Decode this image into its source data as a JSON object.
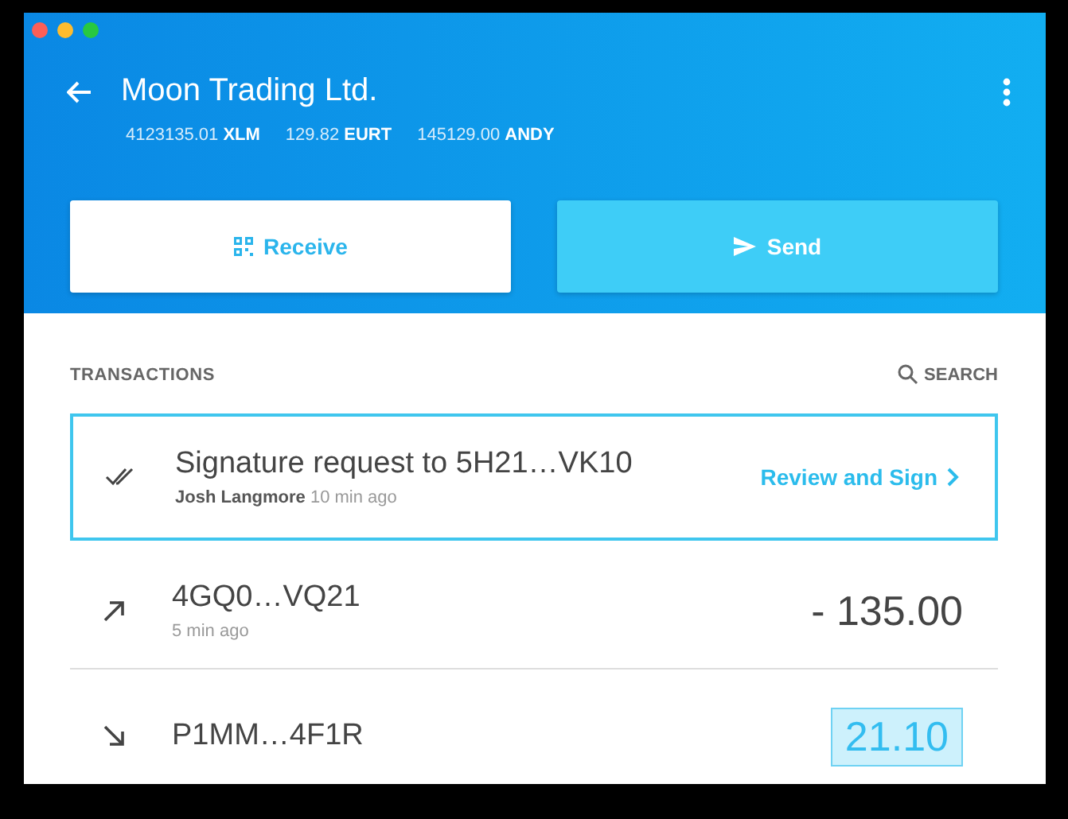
{
  "account": {
    "title": "Moon Trading Ltd.",
    "balances": [
      {
        "amount": "4123135.01",
        "code": "XLM"
      },
      {
        "amount": "129.82",
        "code": "EURT"
      },
      {
        "amount": "145129.00",
        "code": "ANDY"
      }
    ]
  },
  "actions": [
    {
      "label": "Receive",
      "kind": "receive"
    },
    {
      "label": "Send",
      "kind": "send"
    }
  ],
  "transactions": {
    "title": "TRANSACTIONS",
    "search": "SEARCH",
    "items": [
      {
        "kind": "signature",
        "title": "Signature request to 5H21…VK10",
        "author": "Josh Langmore",
        "time": "10 min ago",
        "action": "Review and Sign"
      },
      {
        "kind": "outgoing",
        "title": "4GQ0…VQ21",
        "time": "5 min ago",
        "amount_whole": "- 135",
        "amount_fraction": ".00"
      },
      {
        "kind": "incoming",
        "title": "P1MM…4F1R",
        "amount_whole": "21",
        "amount_fraction": ".10"
      }
    ]
  }
}
